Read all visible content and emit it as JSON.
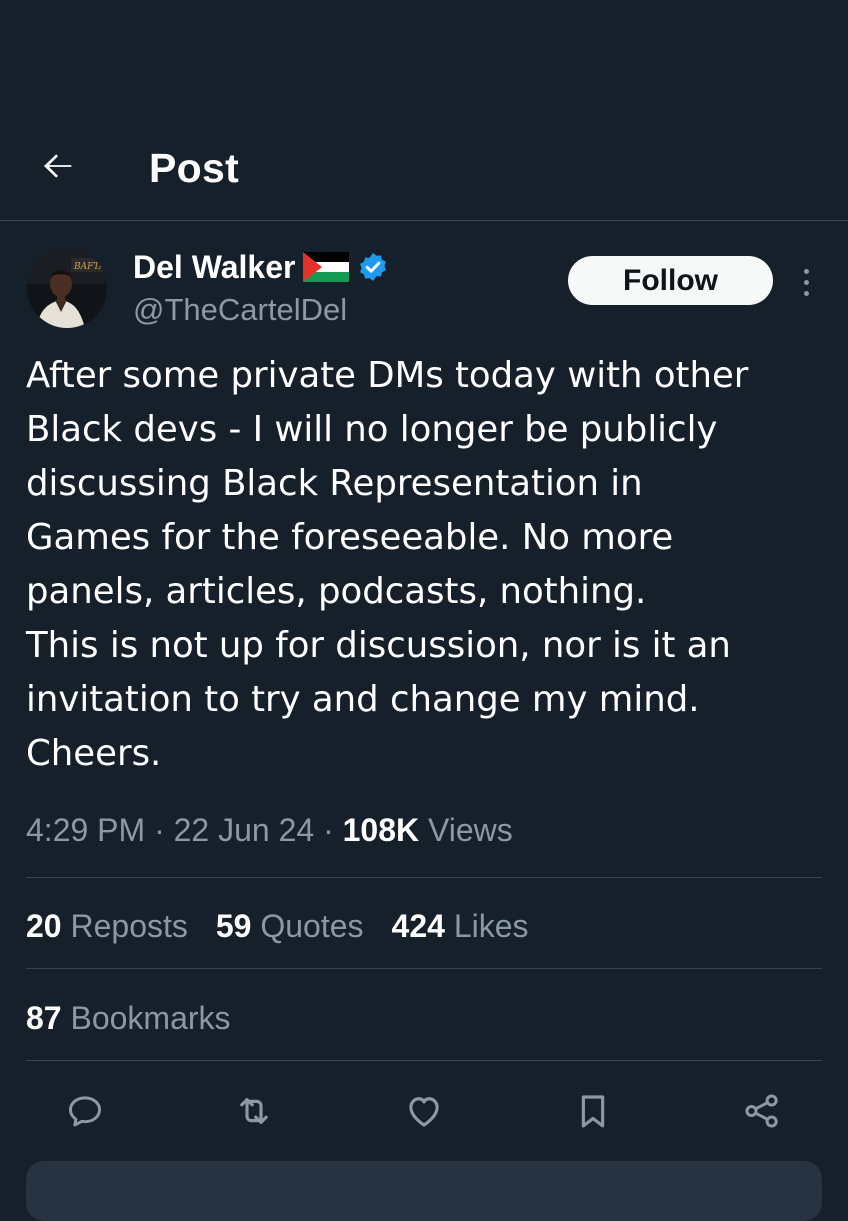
{
  "header": {
    "title": "Post",
    "back_icon": "arrow-left-icon"
  },
  "author": {
    "display_name": "Del Walker",
    "flag_icon": "palestine-flag-icon",
    "verified_icon": "verified-badge-icon",
    "handle": "@TheCartelDel",
    "avatar_logo_text": "BAFTA"
  },
  "follow_label": "Follow",
  "more_icon": "more-vertical-icon",
  "tweet": {
    "text": "After some private DMs today with other\nBlack devs - I will no longer be publicly\ndiscussing Black Representation in\nGames for the foreseeable. No more\npanels, articles, podcasts, nothing.\nThis is not up for discussion, nor is it an\ninvitation to try and change my mind.\nCheers."
  },
  "meta": {
    "time": "4:29 PM",
    "separator": "·",
    "date": "22 Jun 24",
    "views_count": "108K",
    "views_label": "Views"
  },
  "stats": {
    "reposts": {
      "count": "20",
      "label": "Reposts"
    },
    "quotes": {
      "count": "59",
      "label": "Quotes"
    },
    "likes": {
      "count": "424",
      "label": "Likes"
    },
    "bookmarks": {
      "count": "87",
      "label": "Bookmarks"
    }
  },
  "actions": {
    "icons": [
      "reply-icon",
      "repost-icon",
      "like-icon",
      "bookmark-icon",
      "share-icon"
    ]
  },
  "colors": {
    "background": "#15202b",
    "text_primary": "#ffffff",
    "text_secondary": "#8b98a5",
    "divider": "#38444d",
    "follow_bg": "#f7f9f9",
    "verified": "#1d9bf0"
  }
}
